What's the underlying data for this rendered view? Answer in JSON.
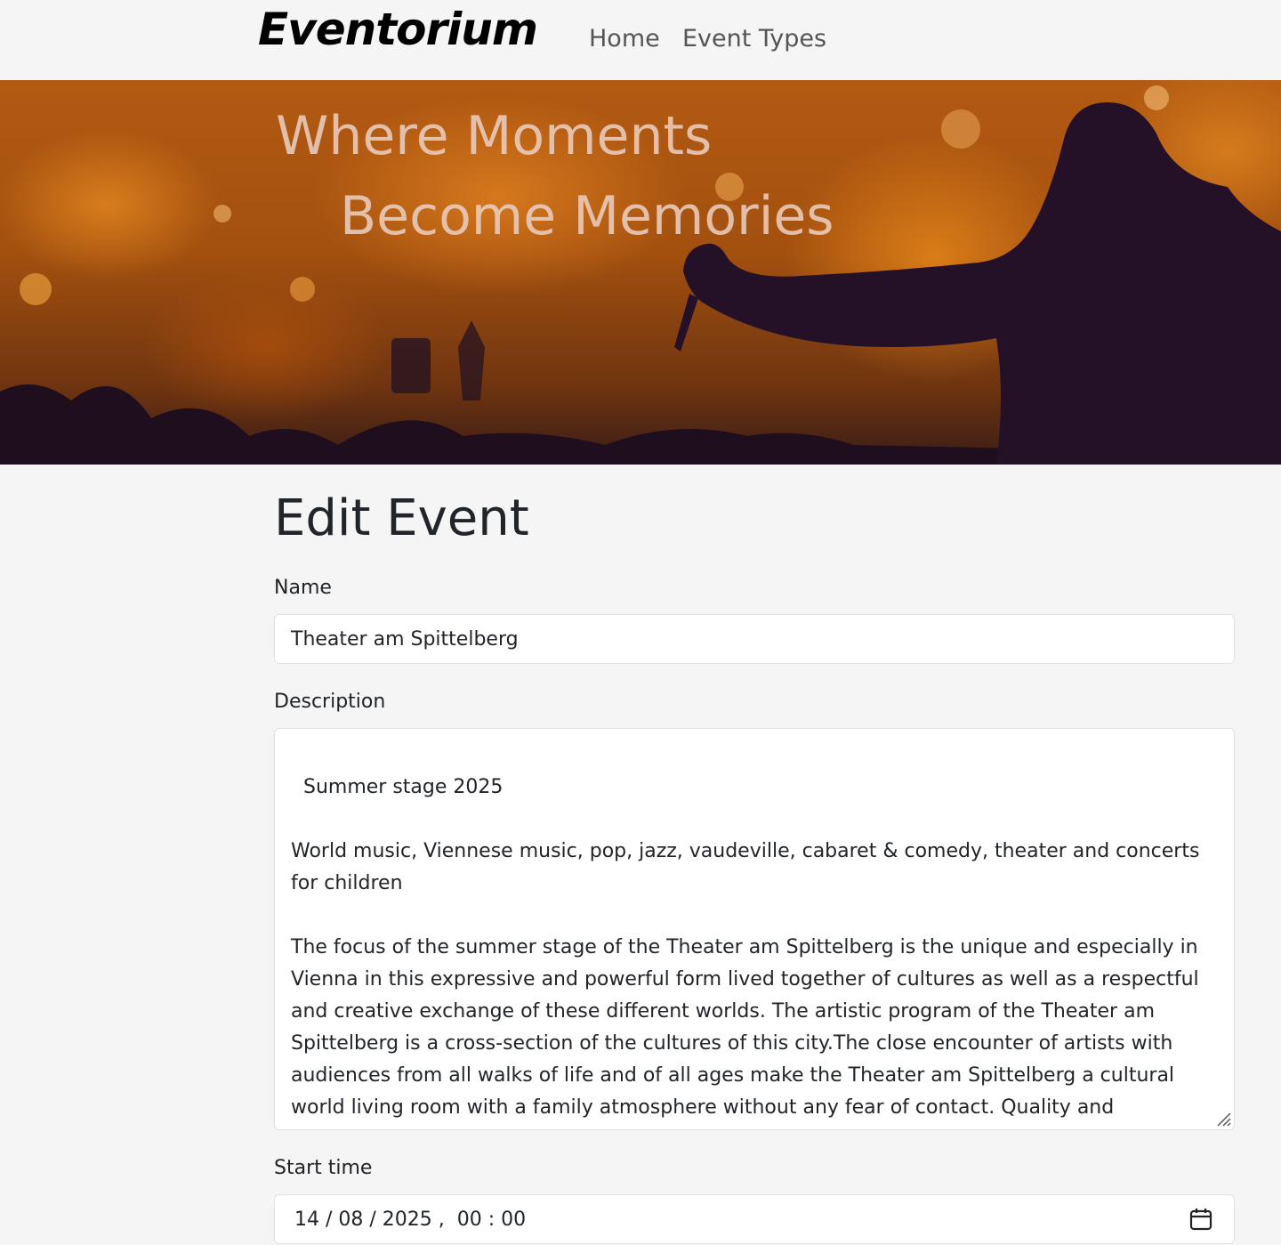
{
  "navbar": {
    "brand": "Eventorium",
    "links": [
      "Home",
      "Event Types"
    ]
  },
  "hero": {
    "line1": "Where Moments",
    "line2": "Become Memories"
  },
  "page": {
    "title": "Edit Event"
  },
  "form": {
    "name_label": "Name",
    "name_value": "Theater am Spittelberg",
    "description_label": "Description",
    "description_value": "Summer stage 2025\n\nWorld music, Viennese music, pop, jazz, vaudeville, cabaret & comedy, theater and concerts for children\n\nThe focus of the summer stage of the Theater am Spittelberg is the unique and especially in Vienna in this expressive and powerful form lived together of cultures as well as a respectful and creative exchange of these different worlds. The artistic program of the Theater am Spittelberg is a cross-section of the cultures of this city.The close encounter of artists with audiences from all walks of life and of all ages make the Theater am Spittelberg a cultural world living room with a family atmosphere without any fear of contact. Quality and originality in a quaint venue with a lively character combine for a multi-faceted audience.",
    "start_time_label": "Start time",
    "start_time_value": "14 / 08 / 2025 ,  00 : 00"
  },
  "icons": {
    "calendar": "calendar-icon",
    "resize": "resize-handle-icon"
  },
  "colors": {
    "page_background": "#f5f5f5",
    "hero_orange": "#b25a12",
    "hero_text": "#ebcdbe",
    "input_border": "#dee2e6"
  }
}
